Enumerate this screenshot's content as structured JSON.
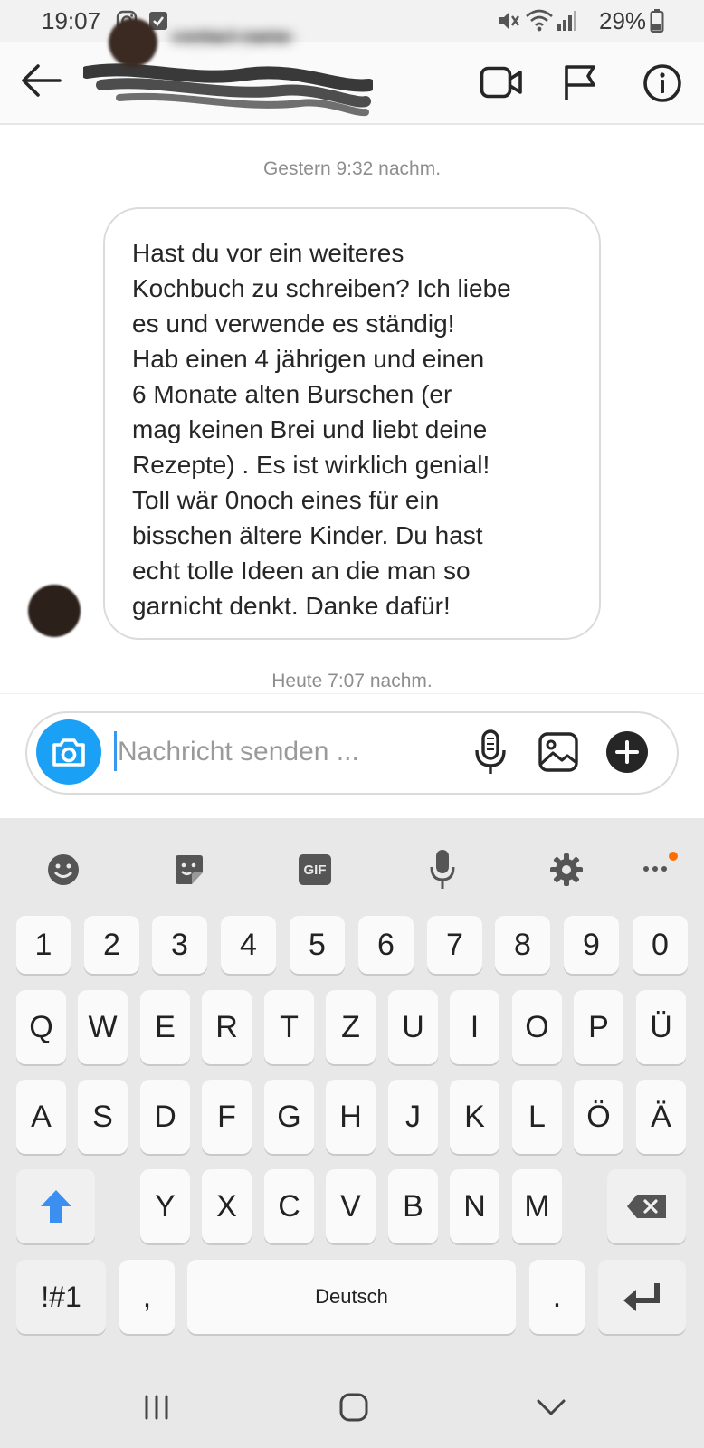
{
  "status_bar": {
    "time": "19:07",
    "battery": "29%"
  },
  "header": {
    "back_icon": "arrow-left-icon",
    "contact_name": "contact-name-redacted",
    "video_icon": "video-camera-icon",
    "flag_icon": "flag-icon",
    "info_icon": "info-icon"
  },
  "chat": {
    "timestamp_1": "Gestern 9:32 nachm.",
    "message_text": "Hast du vor ein weiteres\nKochbuch zu schreiben? Ich liebe\nes und verwende es ständig!\nHab einen 4 jährigen und einen\n6 Monate alten Burschen (er\nmag keinen Brei und liebt deine\nRezepte) . Es ist wirklich genial!\nToll wär 0noch eines für ein\nbisschen ältere Kinder. Du hast\necht tolle Ideen an die man so\ngarnicht denkt. Danke dafür!",
    "timestamp_2": "Heute 7:07 nachm."
  },
  "composer": {
    "placeholder": "Nachricht senden ..."
  },
  "keyboard": {
    "toolbar": [
      "emoji-icon",
      "sticker-icon",
      "gif-icon",
      "mic-icon",
      "settings-icon",
      "more-icon"
    ],
    "gif_label": "GIF",
    "row_numbers": [
      "1",
      "2",
      "3",
      "4",
      "5",
      "6",
      "7",
      "8",
      "9",
      "0"
    ],
    "row1": [
      "Q",
      "W",
      "E",
      "R",
      "T",
      "Z",
      "U",
      "I",
      "O",
      "P",
      "Ü"
    ],
    "row2": [
      "A",
      "S",
      "D",
      "F",
      "G",
      "H",
      "J",
      "K",
      "L",
      "Ö",
      "Ä"
    ],
    "row3": [
      "Y",
      "X",
      "C",
      "V",
      "B",
      "N",
      "M"
    ],
    "symbols_key": "!#1",
    "comma_key": ",",
    "space_key": "Deutsch",
    "period_key": "."
  },
  "colors": {
    "accent_blue": "#3897f0",
    "camera_blue": "#1aa0f5",
    "notification_dot": "#ff6d00"
  }
}
